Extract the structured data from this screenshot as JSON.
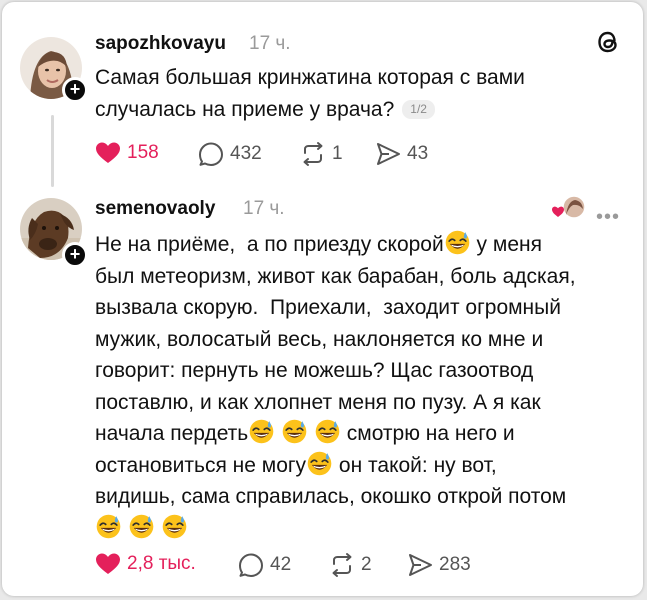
{
  "post1": {
    "username": "sapozhkovayu",
    "time": "17 ч.",
    "text": "Самая большая кринжатина которая с вами\nслучалась на приеме у врача?",
    "pager": "1/2",
    "likes": "158",
    "replies": "432",
    "reposts": "1",
    "shares": "43"
  },
  "post2": {
    "username": "semenovaoly",
    "time": "17 ч.",
    "lines": [
      "Не на приёме,  а по приезду скорой",
      " у меня",
      "был метеоризм, живот как барабан, боль адская,",
      "вызвала скорую.  Приехали,  заходит огромный",
      "мужик, волосатый весь, наклоняется ко мне и",
      "говорит: пернуть не можешь? Щас газоотвод",
      "поставлю, и как хлопнет меня по пузу. А я как",
      "начала пердеть",
      " смотрю на него и",
      "остановиться не могу",
      " он такой: ну вот,",
      "видишь, сама справилась, окошко открой потом"
    ],
    "likes": "2,8 тыс.",
    "replies": "42",
    "reposts": "2",
    "shares": "283"
  },
  "icons": {
    "threads": "threads-logo-icon",
    "emoji": "grinning-sweat-emoji",
    "like": "heart-icon",
    "reply": "speech-bubble-icon",
    "repost": "repost-icon",
    "share": "send-icon",
    "more": "more-options-icon"
  },
  "colors": {
    "like": "#e4205b",
    "muted": "#9a9a9a",
    "text": "#111111"
  }
}
